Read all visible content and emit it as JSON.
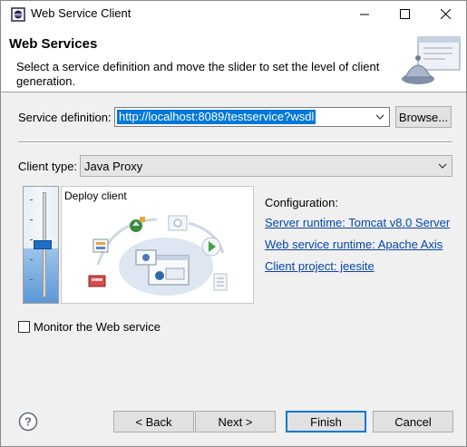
{
  "window": {
    "title": "Web Service Client",
    "icon": "eclipse-app-icon"
  },
  "titlebar_buttons": {
    "minimize_icon": "minimize-icon",
    "maximize_icon": "maximize-icon",
    "close_icon": "close-icon"
  },
  "header": {
    "title": "Web Services",
    "description": "Select a service definition and move the slider to set the level of client generation.",
    "graphic_icon": "web-service-bell-icon"
  },
  "service_definition": {
    "label": "Service definition:",
    "value": "http://localhost:8089/testservice?wsdl",
    "browse_label": "Browse..."
  },
  "client_type": {
    "label": "Client type:",
    "value": "Java Proxy"
  },
  "slider": {
    "level_label": "Deploy client",
    "level_fraction": 0.5
  },
  "configuration": {
    "label": "Configuration:",
    "server_runtime": "Server runtime: Tomcat v8.0 Server",
    "web_service_runtime": "Web service runtime: Apache Axis",
    "client_project": "Client project: jeesite"
  },
  "monitor": {
    "label": "Monitor the Web service",
    "checked": false
  },
  "buttons": {
    "back": "< Back",
    "next": "Next >",
    "finish": "Finish",
    "cancel": "Cancel"
  },
  "colors": {
    "selection": "#0078d7",
    "link": "#0645ad",
    "slider_fill": "#5b98d7"
  }
}
